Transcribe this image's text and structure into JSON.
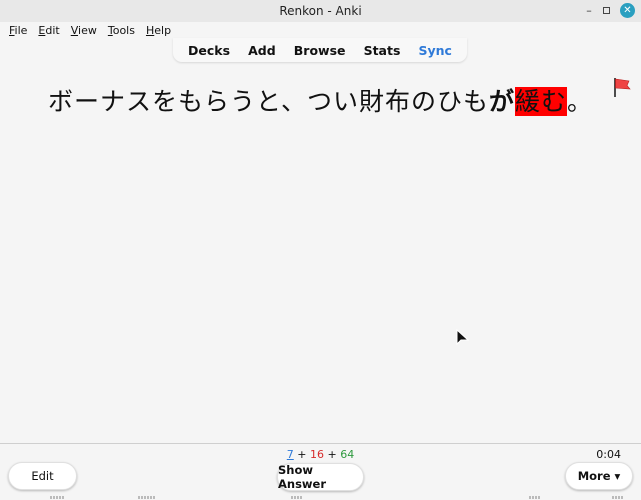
{
  "window": {
    "title": "Renkon - Anki",
    "controls": {
      "minimize": "minimize-icon",
      "maximize": "maximize-icon",
      "close": "close-icon"
    }
  },
  "menubar": {
    "items": [
      {
        "label_first": "F",
        "label_rest": "ile"
      },
      {
        "label_first": "E",
        "label_rest": "dit"
      },
      {
        "label_first": "V",
        "label_rest": "iew"
      },
      {
        "label_first": "T",
        "label_rest": "ools"
      },
      {
        "label_first": "H",
        "label_rest": "elp"
      }
    ]
  },
  "topnav": {
    "items": [
      "Decks",
      "Add",
      "Browse",
      "Stats",
      "Sync"
    ],
    "sync_color": "#2f7ad8"
  },
  "card": {
    "text_before": "ボーナスをもらうと、つい財布のひも",
    "text_bold": "が",
    "text_highlight": "緩む",
    "text_after": "。",
    "highlight_color": "#ff0000",
    "flag": {
      "icon": "flag-icon",
      "color": "#ef4444"
    }
  },
  "bottombar": {
    "counts": {
      "new": "7",
      "plus1": " + ",
      "learn": "16",
      "plus2": " + ",
      "review": "64"
    },
    "count_colors": {
      "new": "#2f7ad8",
      "learn": "#d62a2a",
      "review": "#2e9a3e"
    },
    "timer": "0:04",
    "edit_label": "Edit",
    "show_answer_label": "Show Answer",
    "more_label": "More ▾"
  }
}
